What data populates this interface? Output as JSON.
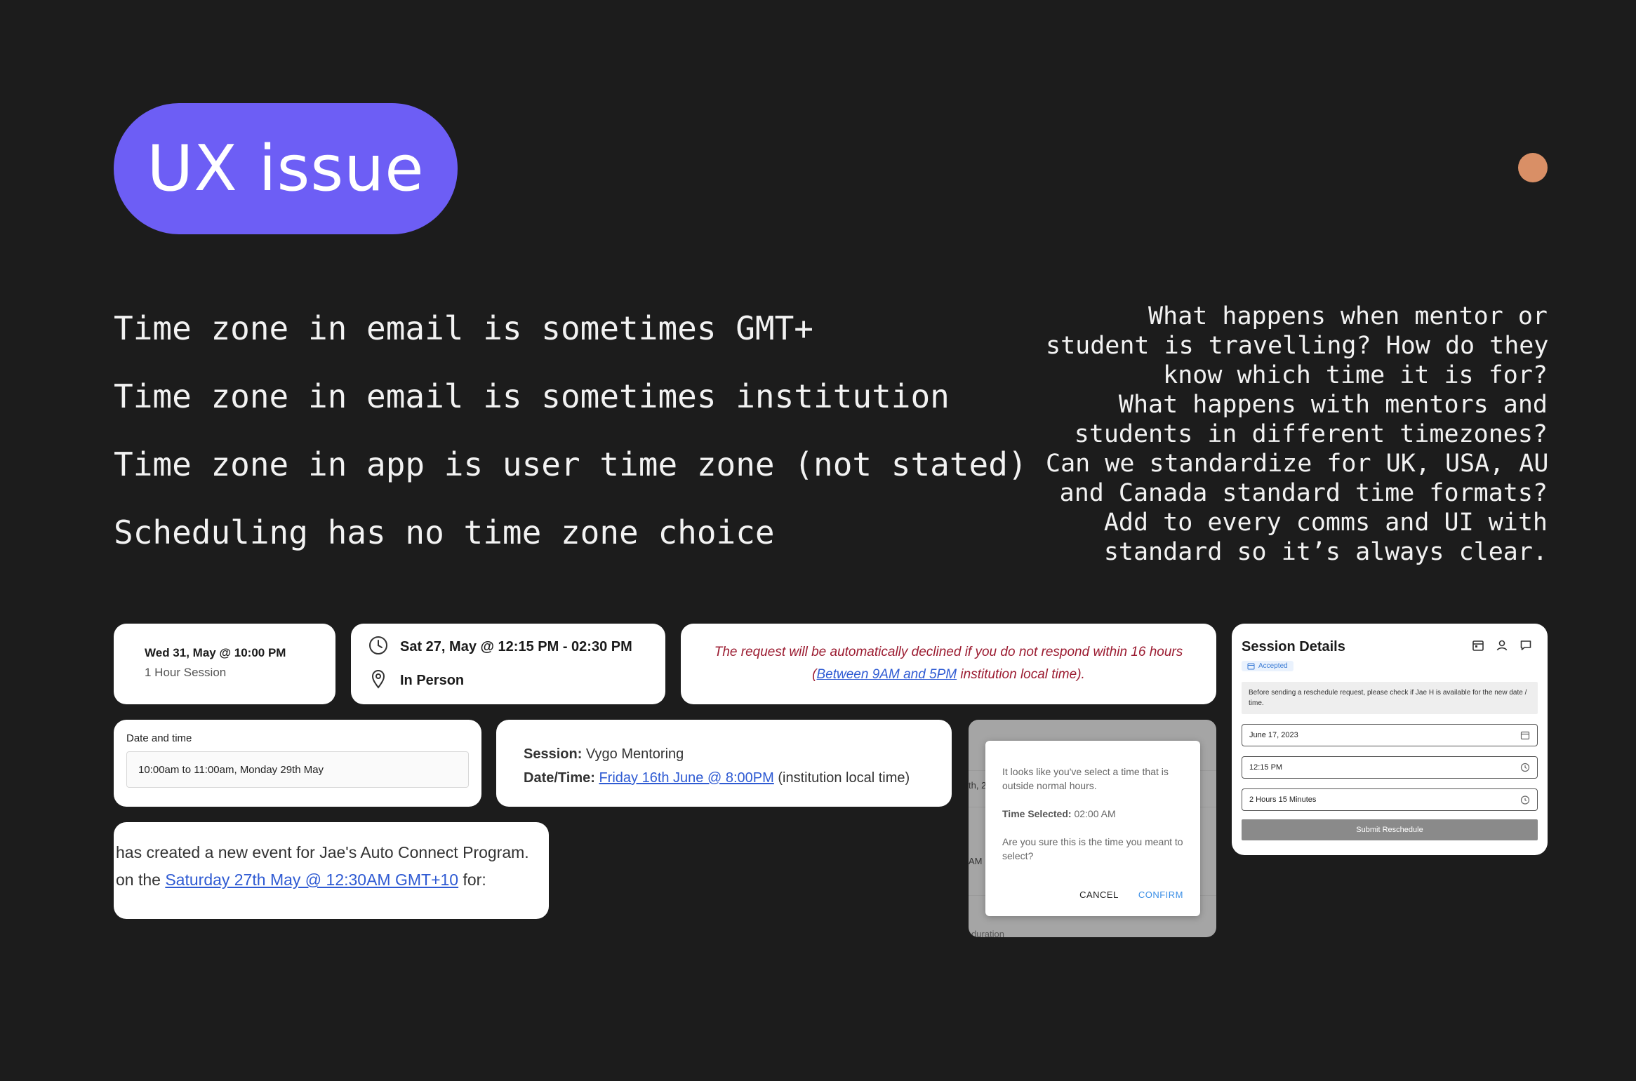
{
  "hero": {
    "title": "UX issue"
  },
  "left_notes": [
    "Time zone in email is sometimes GMT+",
    "Time zone in email is sometimes institution",
    "Time zone in app is user time zone (not stated)",
    "Scheduling has no time zone choice"
  ],
  "right_notes": [
    "What happens when mentor or",
    "student is travelling? How do they",
    "know which time it is for?",
    "What happens with mentors and",
    "students in different timezones?",
    "Can we standardize for UK, USA, AU",
    "and Canada standard time formats?",
    "Add to every comms and UI with",
    "standard so it’s always clear."
  ],
  "card_session_time": {
    "datetime": "Wed 31, May @ 10:00 PM",
    "duration": "1 Hour Session"
  },
  "card_in_person": {
    "datetime": "Sat 27, May @ 12:15 PM - 02:30 PM",
    "location": "In Person"
  },
  "card_decline": {
    "line1": "The request will be automatically declined if you do not respond within 16 hours",
    "paren_open": "(",
    "link": "Between 9AM and 5PM",
    "suffix": " institution local time)."
  },
  "card_date_time": {
    "label": "Date and time",
    "value": "10:00am to 11:00am, Monday 29th May"
  },
  "card_vygo": {
    "session_label": "Session:",
    "session_value": " Vygo Mentoring",
    "datetime_label": "Date/Time:",
    "datetime_link": "Friday 16th June @ 8:00PM",
    "datetime_suffix": " (institution local time)"
  },
  "card_event": {
    "line1": "has created a new event for Jae's Auto Connect Program.",
    "line2_prefix": "on the ",
    "line2_link": "Saturday 27th May @ 12:30AM GMT+10",
    "line2_suffix": " for:"
  },
  "dialog": {
    "message": "It looks like you've select a time that is outside normal hours.",
    "time_label": "Time Selected:",
    "time_value": " 02:00 AM",
    "question": "Are you sure this is the time you meant to select?",
    "cancel": "CANCEL",
    "confirm": "CONFIRM",
    "bg_fragment_1": "th, 2",
    "bg_fragment_2": "AM",
    "bg_fragment_3": "duration"
  },
  "session_details": {
    "title": "Session Details",
    "badge": "Accepted",
    "notice": "Before sending a reschedule request, please check if Jae H is available for the new date / time.",
    "date": "June 17, 2023",
    "time": "12:15 PM",
    "duration": "2 Hours 15 Minutes",
    "submit": "Submit Reschedule"
  },
  "colors": {
    "accent_purple": "#6d5ef5",
    "dot_orange": "#d98f66",
    "background": "#1c1c1c",
    "decline_red": "#9b1b30",
    "link_blue": "#2f5bd3"
  }
}
